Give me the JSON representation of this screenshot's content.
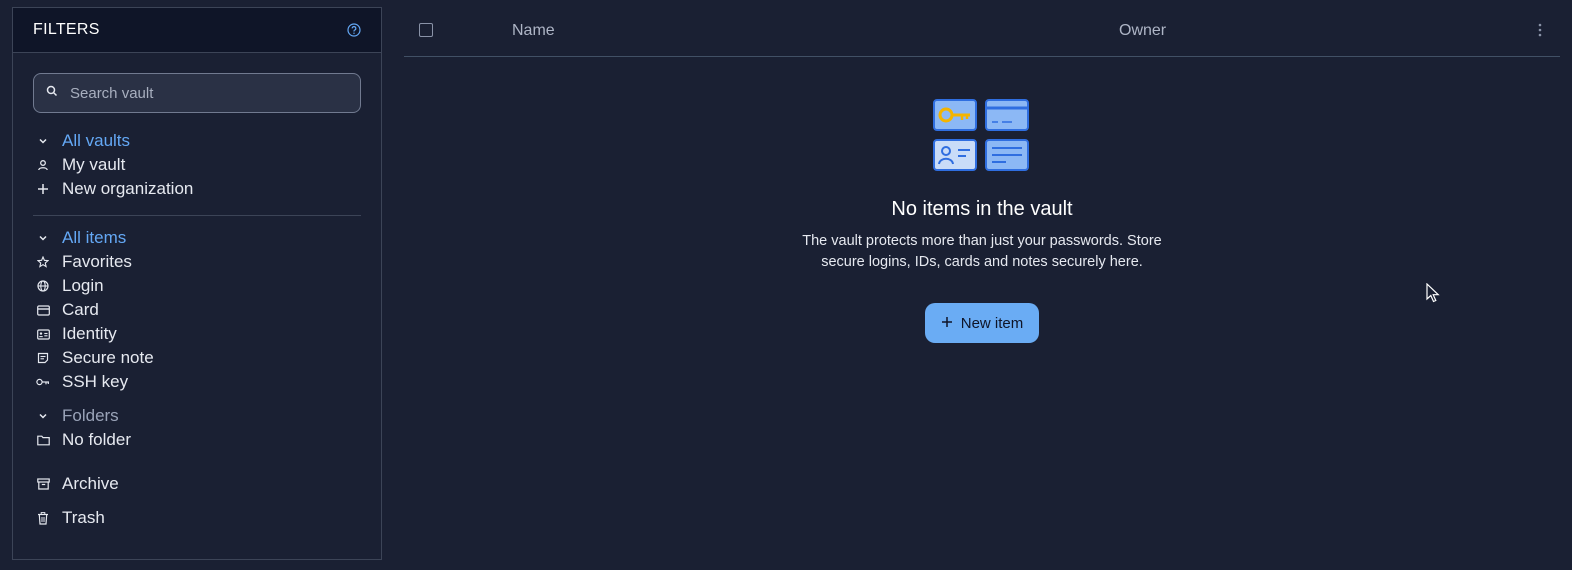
{
  "filters": {
    "title": "FILTERS",
    "search_placeholder": "Search vault",
    "vaults": [
      {
        "label": "All vaults",
        "icon": "chevron-down-icon"
      },
      {
        "label": "My vault",
        "icon": "user-icon"
      },
      {
        "label": "New organization",
        "icon": "plus-icon"
      }
    ],
    "types": [
      {
        "label": "All items",
        "icon": "chevron-down-icon"
      },
      {
        "label": "Favorites",
        "icon": "star-icon"
      },
      {
        "label": "Login",
        "icon": "globe-icon"
      },
      {
        "label": "Card",
        "icon": "credit-card-icon"
      },
      {
        "label": "Identity",
        "icon": "id-card-icon"
      },
      {
        "label": "Secure note",
        "icon": "note-icon"
      },
      {
        "label": "SSH key",
        "icon": "key-icon"
      }
    ],
    "folders": [
      {
        "label": "Folders",
        "icon": "chevron-down-icon"
      },
      {
        "label": "No folder",
        "icon": "folder-icon"
      }
    ],
    "archive": {
      "label": "Archive",
      "icon": "archive-icon"
    },
    "trash": {
      "label": "Trash",
      "icon": "trash-icon"
    }
  },
  "table": {
    "col_name": "Name",
    "col_owner": "Owner"
  },
  "empty_state": {
    "title": "No items in the vault",
    "description": "The vault protects more than just your passwords. Store secure logins, IDs, cards and notes securely here.",
    "button_label": "New item"
  },
  "colors": {
    "background": "#1a2033",
    "accent": "#64a8f5",
    "button": "#6aacf4"
  }
}
